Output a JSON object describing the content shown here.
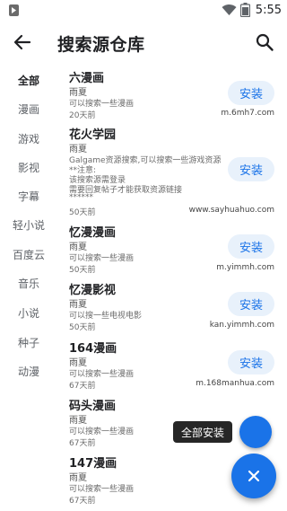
{
  "status_bar": {
    "time": "5:55",
    "icons": [
      "app-notification-icon",
      "wifi-icon",
      "battery-icon"
    ]
  },
  "header": {
    "title": "搜索源仓库",
    "back_icon": "arrow-back-icon",
    "search_icon": "search-icon"
  },
  "sidebar": {
    "items": [
      {
        "label": "全部",
        "active": true
      },
      {
        "label": "漫画"
      },
      {
        "label": "游戏"
      },
      {
        "label": "影视"
      },
      {
        "label": "字幕"
      },
      {
        "label": "轻小说"
      },
      {
        "label": "百度云"
      },
      {
        "label": "音乐"
      },
      {
        "label": "小说"
      },
      {
        "label": "种子"
      },
      {
        "label": "动漫"
      }
    ]
  },
  "sources": [
    {
      "name": "六漫画",
      "author": "雨夏",
      "desc": "可以搜索一些漫画",
      "time": "20天前",
      "url": "m.6mh7.com",
      "button": "安装"
    },
    {
      "name": "花火学园",
      "author": "雨夏",
      "desc_lines": [
        "Galgame资源搜索,可以搜索一些游戏资源",
        "**注意:",
        "该搜索源需登录",
        "需要回复帖子才能获取资源链接",
        "******"
      ],
      "time": "50天前",
      "url": "www.sayhuahuo.com",
      "button": "安装"
    },
    {
      "name": "忆漫漫画",
      "author": "雨夏",
      "desc": "可以搜索一些漫画",
      "time": "50天前",
      "url": "m.yimmh.com",
      "button": "安装"
    },
    {
      "name": "忆漫影视",
      "author": "雨夏",
      "desc": "可以搜一些电视电影",
      "time": "50天前",
      "url": "kan.yimmh.com",
      "button": "安装"
    },
    {
      "name": "164漫画",
      "author": "雨夏",
      "desc": "可以搜索一些漫画",
      "time": "67天前",
      "url": "m.168manhua.com",
      "button": "安装"
    },
    {
      "name": "码头漫画",
      "author": "雨夏",
      "desc": "可以搜索一些漫画",
      "time": "67天前"
    },
    {
      "name": "147漫画",
      "author": "雨夏",
      "desc": "可以搜索一些漫画",
      "time": "67天前"
    }
  ],
  "fab": {
    "tooltip": "全部安装",
    "main_icon": "close-icon"
  },
  "colors": {
    "accent": "#1a73e8",
    "button_bg": "#e8f1fb",
    "tooltip_bg": "#262626"
  }
}
